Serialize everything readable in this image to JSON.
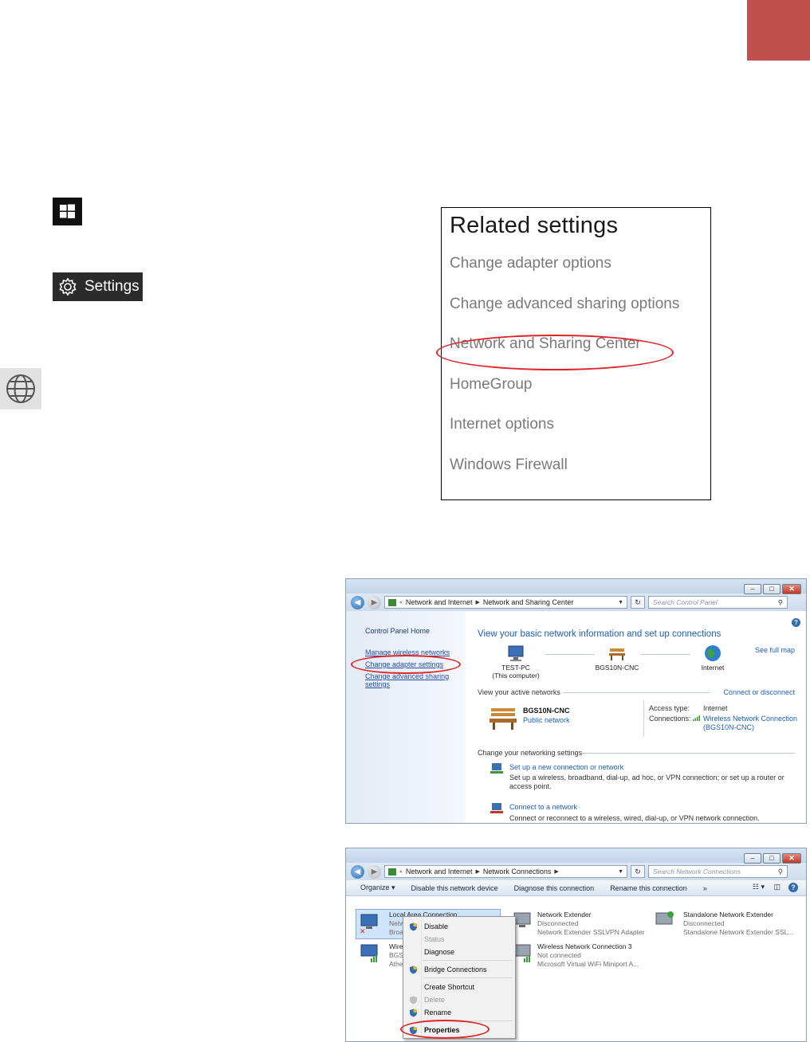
{
  "settings_button": {
    "label": "Settings",
    "icon": "gear-icon"
  },
  "start_button": {
    "icon": "windows-logo-icon"
  },
  "network_tile": {
    "icon": "globe-icon"
  },
  "related": {
    "title": "Related settings",
    "links": [
      "Change adapter options",
      "Change advanced sharing options",
      "Network and Sharing Center",
      "HomeGroup",
      "Internet options",
      "Windows Firewall"
    ],
    "highlighted": "Network and Sharing Center"
  },
  "sharing_center": {
    "breadcrumb": [
      "Network and Internet",
      "Network and Sharing Center"
    ],
    "search_placeholder": "Search Control Panel",
    "sidebar": {
      "home": "Control Panel Home",
      "links": [
        "Manage wireless networks",
        "Change adapter settings",
        "Change advanced sharing settings"
      ],
      "highlighted": "Change adapter settings"
    },
    "heading": "View your basic network information and set up connections",
    "see_full_map": "See full map",
    "map": [
      {
        "name": "TEST-PC",
        "sub": "(This computer)"
      },
      {
        "name": "BGS10N-CNC",
        "sub": ""
      },
      {
        "name": "Internet",
        "sub": ""
      }
    ],
    "active_networks_label": "View your active networks",
    "connect_or_disconnect": "Connect or disconnect",
    "network_name": "BGS10N-CNC",
    "network_type": "Public network",
    "access_type_label": "Access type:",
    "access_type_value": "Internet",
    "connections_label": "Connections:",
    "connection_value": "Wireless Network Connection (BGS10N-CNC)",
    "change_settings_label": "Change your networking settings",
    "tasks": [
      {
        "title": "Set up a new connection or network",
        "desc": "Set up a wireless, broadband, dial-up, ad hoc, or VPN connection; or set up a router or access point."
      },
      {
        "title": "Connect to a network",
        "desc": "Connect or reconnect to a wireless, wired, dial-up, or VPN network connection."
      }
    ]
  },
  "network_connections": {
    "breadcrumb": [
      "Network and Internet",
      "Network Connections"
    ],
    "search_placeholder": "Search Network Connections",
    "commands": [
      "Organize ▾",
      "Disable this network device",
      "Diagnose this connection",
      "Rename this connection",
      "»"
    ],
    "connections": [
      {
        "name": "Local Area Connection",
        "line2": "Netw",
        "line3": "Broa"
      },
      {
        "name": "Wire",
        "line2": "BGS",
        "line3": "Athe"
      },
      {
        "name": "Network Extender",
        "line2": "Disconnected",
        "line3": "Network Extender SSLVPN Adapter"
      },
      {
        "name": "Wireless Network Connection 3",
        "line2": "Not connected",
        "line3": "Microsoft Virtual WiFi Miniport A..."
      },
      {
        "name": "Standalone Network Extender",
        "line2": "Disconnected",
        "line3": "Standalone Network Extender SSL..."
      }
    ],
    "context_menu": [
      "Disable",
      "Status",
      "Diagnose",
      "Bridge Connections",
      "Create Shortcut",
      "Delete",
      "Rename",
      "Properties"
    ],
    "highlighted": "Properties"
  },
  "colors": {
    "accent_tab": "#c0504d",
    "highlight_ring": "#e0242a",
    "link_blue": "#1d5fb3"
  }
}
